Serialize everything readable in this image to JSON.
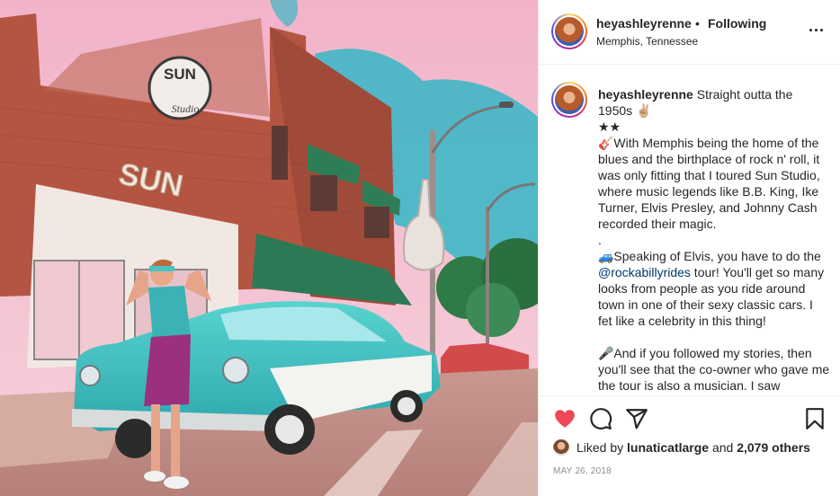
{
  "post": {
    "username": "heyashleyrenne",
    "follow_dot": "•",
    "follow_status": "Following",
    "location": "Memphis, Tennessee",
    "more_icon": "more-options-icon"
  },
  "photo": {
    "building_sign": "SUN",
    "round_sign_top": "SUN",
    "round_sign_bottom": "Studio"
  },
  "caption": {
    "author": "heyashleyrenne",
    "line_1": "Straight outta the 1950s ✌🏼",
    "line_2": "★★",
    "para_1": "🎸With Memphis being the home of the blues and the birthplace of rock n' roll, it was only fitting that I toured Sun Studio, where music legends like B.B. King, Ike Turner, Elvis Presley, and Johnny Cash recorded their magic.",
    "sep_1": ".",
    "para_2_pre": "🚙Speaking of Elvis, you have to do the ",
    "mention": "@rockabillyrides",
    "para_2_post": " tour! You'll get so many looks from people as you ride around town in one of their sexy classic cars. I fet like a celebrity in this thing!",
    "para_3": "🎤And if you followed my stories, then you'll see that the co-owner who gave me the tour is also a musician. I saw"
  },
  "actions": {
    "like_icon": "heart-icon",
    "comment_icon": "comment-icon",
    "share_icon": "share-icon",
    "save_icon": "bookmark-icon",
    "liked_color": "#ed4956"
  },
  "likes": {
    "prefix": "Liked by",
    "user": "lunaticatlarge",
    "and": "and",
    "others": "2,079 others"
  },
  "date": "MAY 26, 2018"
}
